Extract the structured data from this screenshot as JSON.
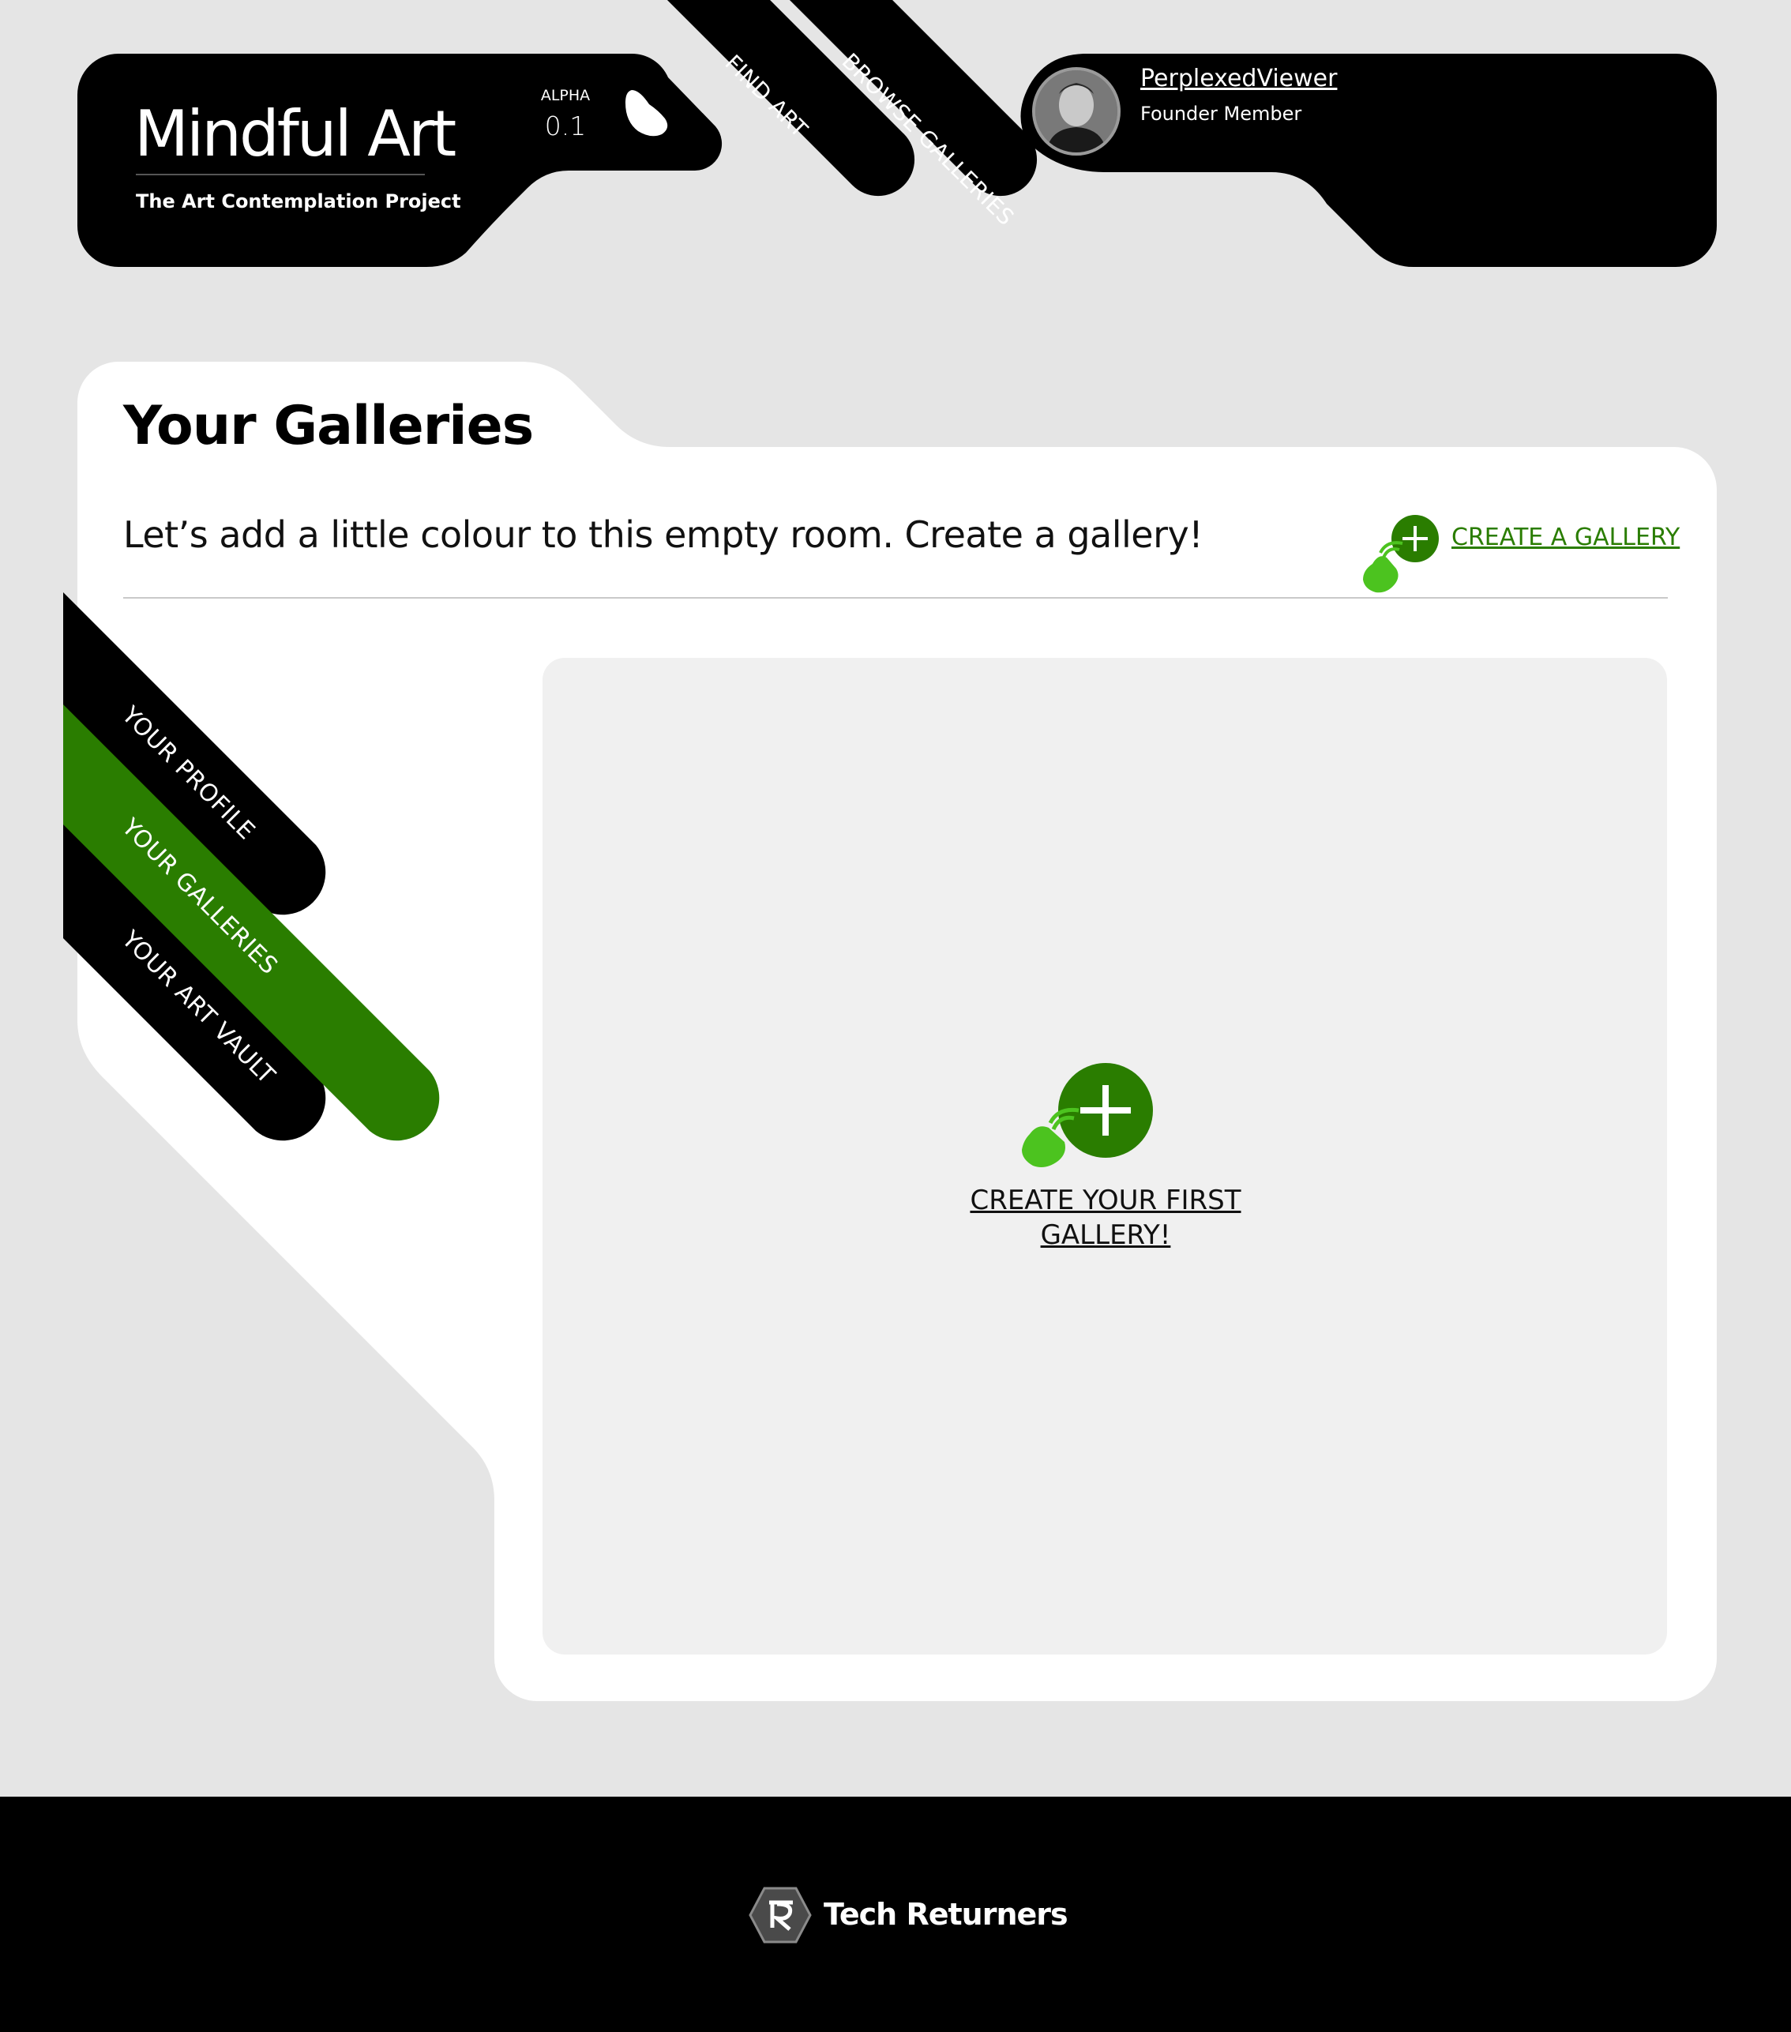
{
  "header": {
    "brand_title": "Mindful Art",
    "brand_subtitle": "The Art Contemplation Project",
    "version_label": "ALPHA",
    "version_number": "0.1",
    "nav": {
      "find_art": "FIND ART",
      "browse_galleries": "BROWSE GALLERIES"
    },
    "user": {
      "username": "PerplexedViewer",
      "role": "Founder Member"
    }
  },
  "main": {
    "title": "Your Galleries",
    "intro": "Let’s add a little colour to this empty room. Create a gallery!",
    "create_link": "CREATE A GALLERY",
    "side_tabs": [
      {
        "label": "YOUR PROFILE",
        "active": false
      },
      {
        "label": "YOUR GALLERIES",
        "active": true
      },
      {
        "label": "YOUR ART VAULT",
        "active": false
      }
    ],
    "empty_state": {
      "cta_line1": "CREATE YOUR FIRST",
      "cta_line2": "GALLERY!"
    }
  },
  "footer": {
    "brand": "Tech Returners"
  },
  "colors": {
    "accent_green": "#2a7d00",
    "hand_green": "#4cc31f",
    "background": "#e5e5e5",
    "panel": "#ffffff",
    "bar": "#000000"
  },
  "icons": [
    "add-circle-icon",
    "tap-hand-icon",
    "leaf-icon",
    "tech-returners-logo-icon"
  ]
}
